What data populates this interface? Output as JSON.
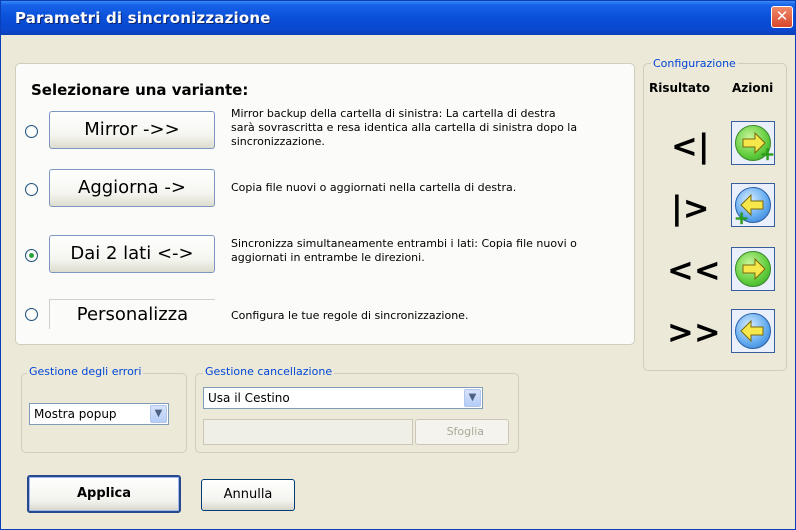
{
  "window": {
    "title": "Parametri di sincronizzazione",
    "close_icon": "close-x-icon"
  },
  "variants": {
    "heading": "Selezionare una variante:",
    "options": [
      {
        "label": "Mirror ->>",
        "checked": false,
        "description_lines": [
          "Mirror backup della cartella di sinistra: La cartella di destra",
          "sarà sovrascritta e resa identica alla cartella di sinistra dopo la",
          "sincronizzazione."
        ]
      },
      {
        "label": "Aggiorna ->",
        "checked": false,
        "description_lines": [
          "Copia file nuovi o aggiornati nella cartella di destra."
        ]
      },
      {
        "label": "Dai 2 lati <->",
        "checked": true,
        "description_lines": [
          "Sincronizza simultaneamente entrambi i lati: Copia file nuovi o",
          "aggiornati in entrambe le direzioni."
        ]
      },
      {
        "label": "Personalizza",
        "checked": false,
        "description_lines": [
          "Configura le tue regole di sincronizzazione."
        ]
      }
    ]
  },
  "configurazione": {
    "legend": "Configurazione",
    "col_result": "Risultato",
    "col_actions": "Azioni",
    "rows": [
      {
        "result": "<|",
        "action_icon": "green-arrow-right-plus-icon"
      },
      {
        "result": "|>",
        "action_icon": "blue-arrow-left-plus-icon"
      },
      {
        "result": "<<",
        "action_icon": "green-arrow-right-icon"
      },
      {
        "result": ">>",
        "action_icon": "blue-arrow-left-icon"
      }
    ]
  },
  "errori": {
    "legend": "Gestione degli errori",
    "selected": "Mostra popup"
  },
  "cancellazione": {
    "legend": "Gestione cancellazione",
    "selected": "Usa il Cestino",
    "path_value": "",
    "browse_label": "Sfoglia"
  },
  "buttons": {
    "apply": "Applica",
    "cancel": "Annulla"
  },
  "colors": {
    "titlebar": "#0a4fd8",
    "face": "#ece9d8",
    "legend_text": "#0046d5",
    "green": "#5fcc3c",
    "blue": "#5ea8ee"
  }
}
